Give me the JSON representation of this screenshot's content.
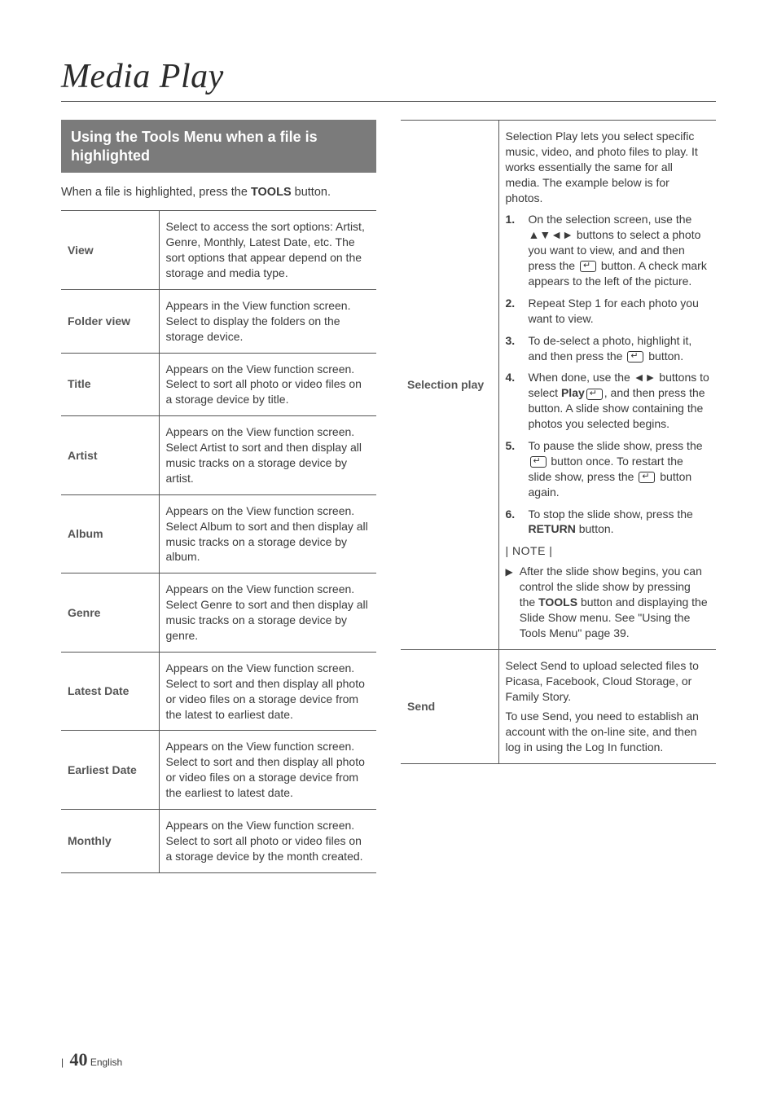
{
  "page_title": "Media Play",
  "section_heading": "Using the Tools Menu when a file is highlighted",
  "intro_prefix": "When a file is highlighted, press the ",
  "intro_bold": "TOOLS",
  "intro_suffix": " button.",
  "left_table": {
    "rows": [
      {
        "label": "View",
        "desc": "Select to access the sort options: Artist, Genre, Monthly, Latest Date, etc. The sort options that appear depend on the storage and media type."
      },
      {
        "label": "Folder view",
        "desc": "Appears in the View function screen. Select to display the folders on the storage device."
      },
      {
        "label": "Title",
        "desc": "Appears on the View function screen. Select to sort all photo or video files on a storage device by title."
      },
      {
        "label": "Artist",
        "desc": "Appears on the View function screen. Select Artist to sort and then display all music tracks on a storage device by artist."
      },
      {
        "label": "Album",
        "desc": "Appears on the View function screen. Select Album to sort and then display all music tracks on a storage device by album."
      },
      {
        "label": "Genre",
        "desc": "Appears on the View function screen. Select Genre to sort and then display all music tracks on a storage device by genre."
      },
      {
        "label": "Latest Date",
        "desc": "Appears on the View function screen. Select to sort and then display all photo or video files on a storage device from the latest to earliest date."
      },
      {
        "label": "Earliest Date",
        "desc": "Appears on the View function screen. Select to sort and then display all photo or video files on a storage device from the earliest to latest date."
      },
      {
        "label": "Monthly",
        "desc": "Appears on the View function screen. Select to sort all photo or video files on a storage device by the month created."
      }
    ]
  },
  "right_table": {
    "selection_play": {
      "label": "Selection play",
      "intro": "Selection Play lets you select specific music, video, and photo files to play. It works essentially the same for all media. The example below is for photos.",
      "steps": [
        {
          "n": "1.",
          "pre": "On the selection screen, use the ▲▼◄► buttons to select a photo you want to view, and and then press the ",
          "icon": true,
          "post": " button. A check mark appears to the left of the picture."
        },
        {
          "n": "2.",
          "pre": "Repeat Step 1 for each photo you want to view.",
          "icon": false,
          "post": ""
        },
        {
          "n": "3.",
          "pre": "To de-select a photo, highlight it, and then press the ",
          "icon": true,
          "post": " button."
        },
        {
          "n": "4.",
          "pre": "When done, use the ◄► buttons to select ",
          "bold1": "Play",
          "mid": ", and then press the ",
          "icon": true,
          "post": " button. A slide show containing the photos you selected begins."
        },
        {
          "n": "5.",
          "pre": "To pause the slide show, press the ",
          "icon": true,
          "mid": " button once. To restart the slide show, press the ",
          "icon2": true,
          "post": " button again."
        },
        {
          "n": "6.",
          "pre": "To stop the slide show, press the ",
          "bold1": "RETURN",
          "post": " button."
        }
      ],
      "note_label": "| NOTE |",
      "note_bullet": "▶",
      "note_pre": "After the slide show begins, you can control the slide show by pressing the ",
      "note_bold": "TOOLS",
      "note_post": " button and displaying the Slide Show menu. See \"Using the Tools Menu\" page 39."
    },
    "send": {
      "label": "Send",
      "desc1": "Select Send to upload selected files to Picasa, Facebook, Cloud Storage, or Family Story.",
      "desc2": "To use Send, you need to establish an account with the on-line site, and then log in using the Log In function."
    }
  },
  "footer": {
    "bar": "|",
    "page_num": "40",
    "lang": "English"
  }
}
